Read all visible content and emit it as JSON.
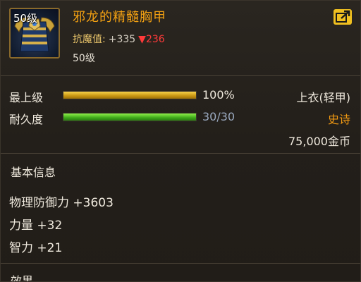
{
  "item": {
    "level_badge": "50级",
    "name": "邪龙的精髓胸甲",
    "magic_resist_label": "抗魔值:",
    "magic_resist_value": "+335",
    "magic_resist_diff": "▼236",
    "level_text": "50级"
  },
  "bars": {
    "level": {
      "label": "最上级",
      "value_text": "100%",
      "fill_percent": 100,
      "color": "#d9a515"
    },
    "durability": {
      "label": "耐久度",
      "value_text": "30/30",
      "fill_percent": 100,
      "color": "#4cc21f"
    }
  },
  "meta": {
    "slot_type": "上衣(轻甲)",
    "rarity": "史诗",
    "rarity_color": "#f29a12",
    "price": "75,000金币"
  },
  "basic_info": {
    "title": "基本信息",
    "stats": [
      "物理防御力 +3603",
      "力量 +32",
      "智力 +21"
    ]
  },
  "effect": {
    "title": "效果"
  },
  "icons": {
    "item": "chest-armor-icon",
    "share": "share-icon"
  }
}
